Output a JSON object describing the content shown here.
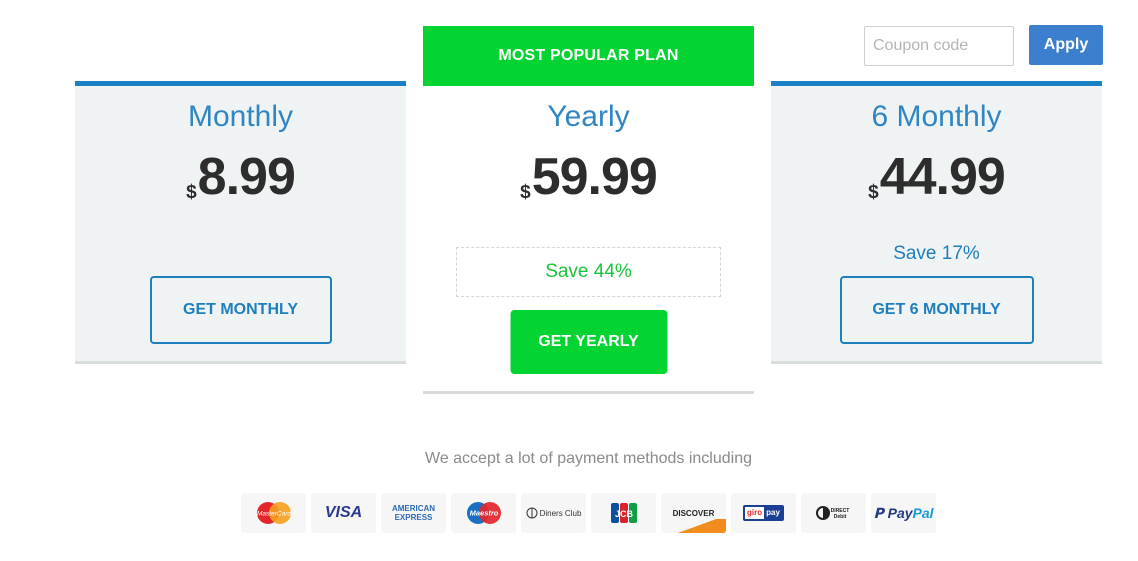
{
  "coupon": {
    "placeholder": "Coupon code",
    "apply_label": "Apply"
  },
  "plans": {
    "monthly": {
      "name": "Monthly",
      "currency": "$",
      "price": "8.99",
      "button": "GET MONTHLY"
    },
    "yearly": {
      "banner": "MOST POPULAR PLAN",
      "name": "Yearly",
      "currency": "$",
      "price": "59.99",
      "save": "Save 44%",
      "button": "GET YEARLY"
    },
    "six_monthly": {
      "name": "6 Monthly",
      "currency": "$",
      "price": "44.99",
      "save": "Save 17%",
      "button": "GET 6 MONTHLY"
    }
  },
  "payment": {
    "caption": "We accept a lot of payment methods including",
    "methods": [
      {
        "icon": "mastercard-icon",
        "text": "MasterCard"
      },
      {
        "icon": "visa-icon",
        "text": "VISA"
      },
      {
        "icon": "american-express-icon",
        "line1": "AMERICAN",
        "line2": "EXPRESS"
      },
      {
        "icon": "maestro-icon",
        "text": "Maestro"
      },
      {
        "icon": "diners-club-icon",
        "text": "Diners Club"
      },
      {
        "icon": "jcb-icon",
        "text": "JCB"
      },
      {
        "icon": "discover-icon",
        "text": "DISCOVER"
      },
      {
        "icon": "giropay-icon",
        "left": "giro",
        "right": "pay"
      },
      {
        "icon": "direct-debit-icon",
        "line1": "DIRECT",
        "line2": "Debit"
      },
      {
        "icon": "paypal-icon",
        "part1": "Pay",
        "part2": "Pal"
      }
    ]
  },
  "colors": {
    "brand_blue": "#1e7fbe",
    "apply_blue": "#3d7fcf",
    "popular_green": "#03d431",
    "save_green": "#19c43a",
    "card_bg": "#eff3f4"
  }
}
